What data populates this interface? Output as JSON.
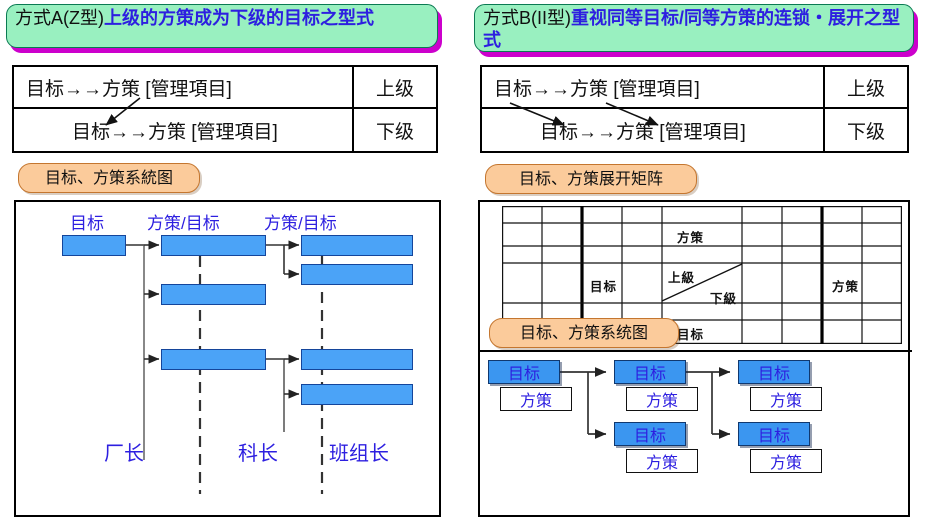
{
  "panels": {
    "left": {
      "banner": {
        "prefix": "方式A(Z型)",
        "emphasis": "上级的方策成为下级的目标之型式"
      },
      "table": {
        "rows": [
          {
            "text": "目标→→方策 [管理項目]",
            "level": "上级"
          },
          {
            "text": "目标→→方策 [管理項目]",
            "level": "下级"
          }
        ]
      },
      "pill": "目标、方策系統图",
      "diagram": {
        "column_headers": [
          "目标",
          "方策/目标",
          "方策/目标"
        ],
        "role_labels": [
          "厂长",
          "科长",
          "班组长"
        ],
        "boxes_unlabeled": 8
      }
    },
    "right": {
      "banner": {
        "prefix": "方式B(II型)",
        "emphasis": "重视同等目标/同等方策的连锁・展开之型式"
      },
      "table": {
        "rows": [
          {
            "text": "目标→→方策 [管理項目]",
            "level": "上级"
          },
          {
            "text": "目标→→方策 [管理項目]",
            "level": "下级"
          }
        ]
      },
      "pill_matrix": "目标、方策展开矩阵",
      "matrix": {
        "cols": 10,
        "rows": 8,
        "labels": {
          "top_center": "方策",
          "left_center": "目标",
          "right_center": "方策",
          "bottom_center": "目标",
          "diag_upper": "上級",
          "diag_lower": "下級"
        }
      },
      "pill_tree": "目标、方策系统图",
      "tree": {
        "goal_label": "目标",
        "plan_label": "方策",
        "nodes": [
          {
            "goal": "目标",
            "plan": "方策"
          },
          {
            "goal": "目标",
            "plan": "方策"
          },
          {
            "goal": "目标",
            "plan": "方策"
          },
          {
            "goal": "目标",
            "plan": "方策"
          },
          {
            "goal": "目标",
            "plan": "方策"
          }
        ]
      }
    }
  },
  "colors": {
    "banner_fill": "#99f0c0",
    "banner_shadow": "#cc00cc",
    "pill_fill": "#fbcb9b",
    "box_blue": "#4ba3f7",
    "text_blue": "#2d1fe0"
  }
}
